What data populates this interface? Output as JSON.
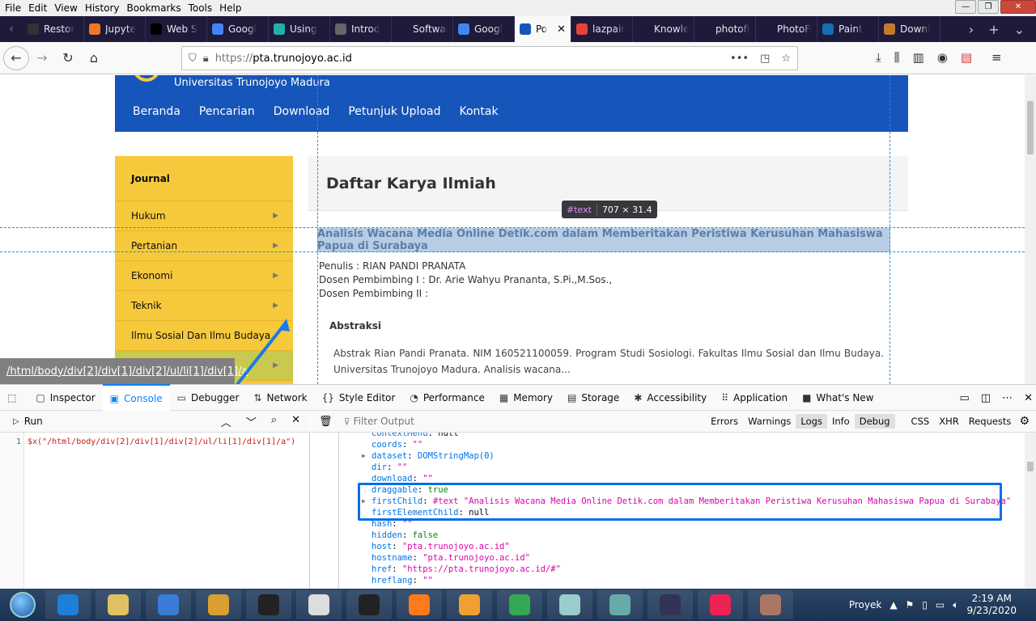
{
  "menu": [
    "File",
    "Edit",
    "View",
    "History",
    "Bookmarks",
    "Tools",
    "Help"
  ],
  "window_controls": {
    "minimize": "—",
    "maximize": "❐",
    "close": "✕"
  },
  "tabs": [
    {
      "label": "Restor",
      "icon": "warning-icon",
      "color": "#333"
    },
    {
      "label": "Jupyte",
      "icon": "jupyter-icon",
      "color": "#f37626"
    },
    {
      "label": "Web S",
      "icon": "medium-icon",
      "color": "#000"
    },
    {
      "label": "Googl",
      "icon": "google-translate-icon",
      "color": "#4285f4"
    },
    {
      "label": "Using",
      "icon": "dot-icon",
      "color": "#20b2aa"
    },
    {
      "label": "Introd",
      "icon": "lc-icon",
      "color": "#666"
    },
    {
      "label": "Software C",
      "icon": "none",
      "color": "transparent"
    },
    {
      "label": "Googl",
      "icon": "google-translate-icon",
      "color": "#4285f4"
    },
    {
      "label": "Po",
      "icon": "page-icon",
      "color": "#1655b9",
      "active": true
    },
    {
      "label": "lazpair",
      "icon": "google-icon",
      "color": "#ea4335"
    },
    {
      "label": "Knowledg",
      "icon": "none",
      "color": "transparent"
    },
    {
      "label": "photofiltre",
      "icon": "none",
      "color": "transparent"
    },
    {
      "label": "PhotoFiltre",
      "icon": "none",
      "color": "transparent"
    },
    {
      "label": "Paint",
      "icon": "amazon-icon",
      "color": "#146eb4"
    },
    {
      "label": "Downl",
      "icon": "palette-icon",
      "color": "#c47a2c"
    }
  ],
  "url": {
    "scheme": "https://",
    "host": "pta.trunojoyo.ac.id",
    "more": "•••"
  },
  "site": {
    "name": "Universitas Trunojoyo Madura",
    "nav": [
      "Beranda",
      "Pencarian",
      "Download",
      "Petunjuk Upload",
      "Kontak"
    ],
    "sidebar_title": "Journal",
    "sidebar_items": [
      "Hukum",
      "Pertanian",
      "Ekonomi",
      "Teknik",
      "Ilmu Sosial Dan Ilmu Budaya"
    ],
    "page_title": "Daftar Karya Ilmiah",
    "article_title": "Analisis Wacana Media Online Detik.com dalam Memberitakan Peristiwa Kerusuhan Mahasiswa Papua di Surabaya",
    "penulis": "Penulis : RIAN PANDI PRANATA",
    "dosen1": "Dosen Pembimbing I : Dr. Arie Wahyu Prananta, S.Pi.,M.Sos.,",
    "dosen2": "Dosen Pembimbing II :",
    "abstract_heading": "Abstraksi",
    "abstract_text": "Abstrak Rian Pandi Pranata. NIM 160521100059. Program Studi Sosiologi. Fakultas Ilmu Sosial dan Ilmu Budaya. Universitas Trunojoyo Madura. Analisis wacana..."
  },
  "tooltip": {
    "node": "#text",
    "size": "707 × 31.4"
  },
  "xpath_overlay": "/html/body/div[2]/div[1]/div[2]/ul/li[1]/div[1]/a",
  "devtools": {
    "tabs": [
      "Inspector",
      "Console",
      "Debugger",
      "Network",
      "Style Editor",
      "Performance",
      "Memory",
      "Storage",
      "Accessibility",
      "Application",
      "What's New"
    ],
    "active_tab": "Console",
    "run_label": "Run",
    "filter_placeholder": "Filter Output",
    "filters": [
      "Errors",
      "Warnings",
      "Logs",
      "Info",
      "Debug",
      "CSS",
      "XHR",
      "Requests"
    ],
    "editor_line_no": "1",
    "editor_code": "$x(\"/html/body/div[2]/div[1]/div[2]/ul/li[1]/div[1]/a\")",
    "props": [
      {
        "k": "contextMenu",
        "v": "null",
        "t": "pt"
      },
      {
        "k": "coords",
        "v": "\"\"",
        "t": "ps"
      },
      {
        "k": "dataset",
        "v": "DOMStringMap(0)",
        "t": "pk",
        "expand": true
      },
      {
        "k": "dir",
        "v": "\"\"",
        "t": "ps"
      },
      {
        "k": "download",
        "v": "\"\"",
        "t": "ps"
      },
      {
        "k": "draggable",
        "v": "true",
        "t": "pn"
      },
      {
        "k": "firstChild",
        "v": "#text \"Analisis Wacana Media Online Detik.com dalam Memberitakan Peristiwa Kerusuhan Mahasiswa Papua di Surabaya\"",
        "t": "ps",
        "expand": true
      },
      {
        "k": "firstElementChild",
        "v": "null",
        "t": "pt"
      },
      {
        "k": "hash",
        "v": "\"\"",
        "t": "ps"
      },
      {
        "k": "hidden",
        "v": "false",
        "t": "pn"
      },
      {
        "k": "host",
        "v": "\"pta.trunojoyo.ac.id\"",
        "t": "ps"
      },
      {
        "k": "hostname",
        "v": "\"pta.trunojoyo.ac.id\"",
        "t": "ps"
      },
      {
        "k": "href",
        "v": "\"https://pta.trunojoyo.ac.id/#\"",
        "t": "ps"
      },
      {
        "k": "hreflang",
        "v": "\"\"",
        "t": "ps"
      }
    ]
  },
  "taskbar": {
    "apps": [
      "ie-icon",
      "file-explorer-icon",
      "media-player-icon",
      "network-icon",
      "cmd-icon",
      "text-editor-icon",
      "cmd-icon",
      "firefox-icon",
      "pdf-icon",
      "chrome-icon",
      "glass-app-icon",
      "control-panel-icon",
      "3g-modem-icon",
      "photofiltre-icon",
      "paint-icon"
    ],
    "proyek": "Proyek",
    "time": "2:19 AM",
    "date": "9/23/2020"
  }
}
